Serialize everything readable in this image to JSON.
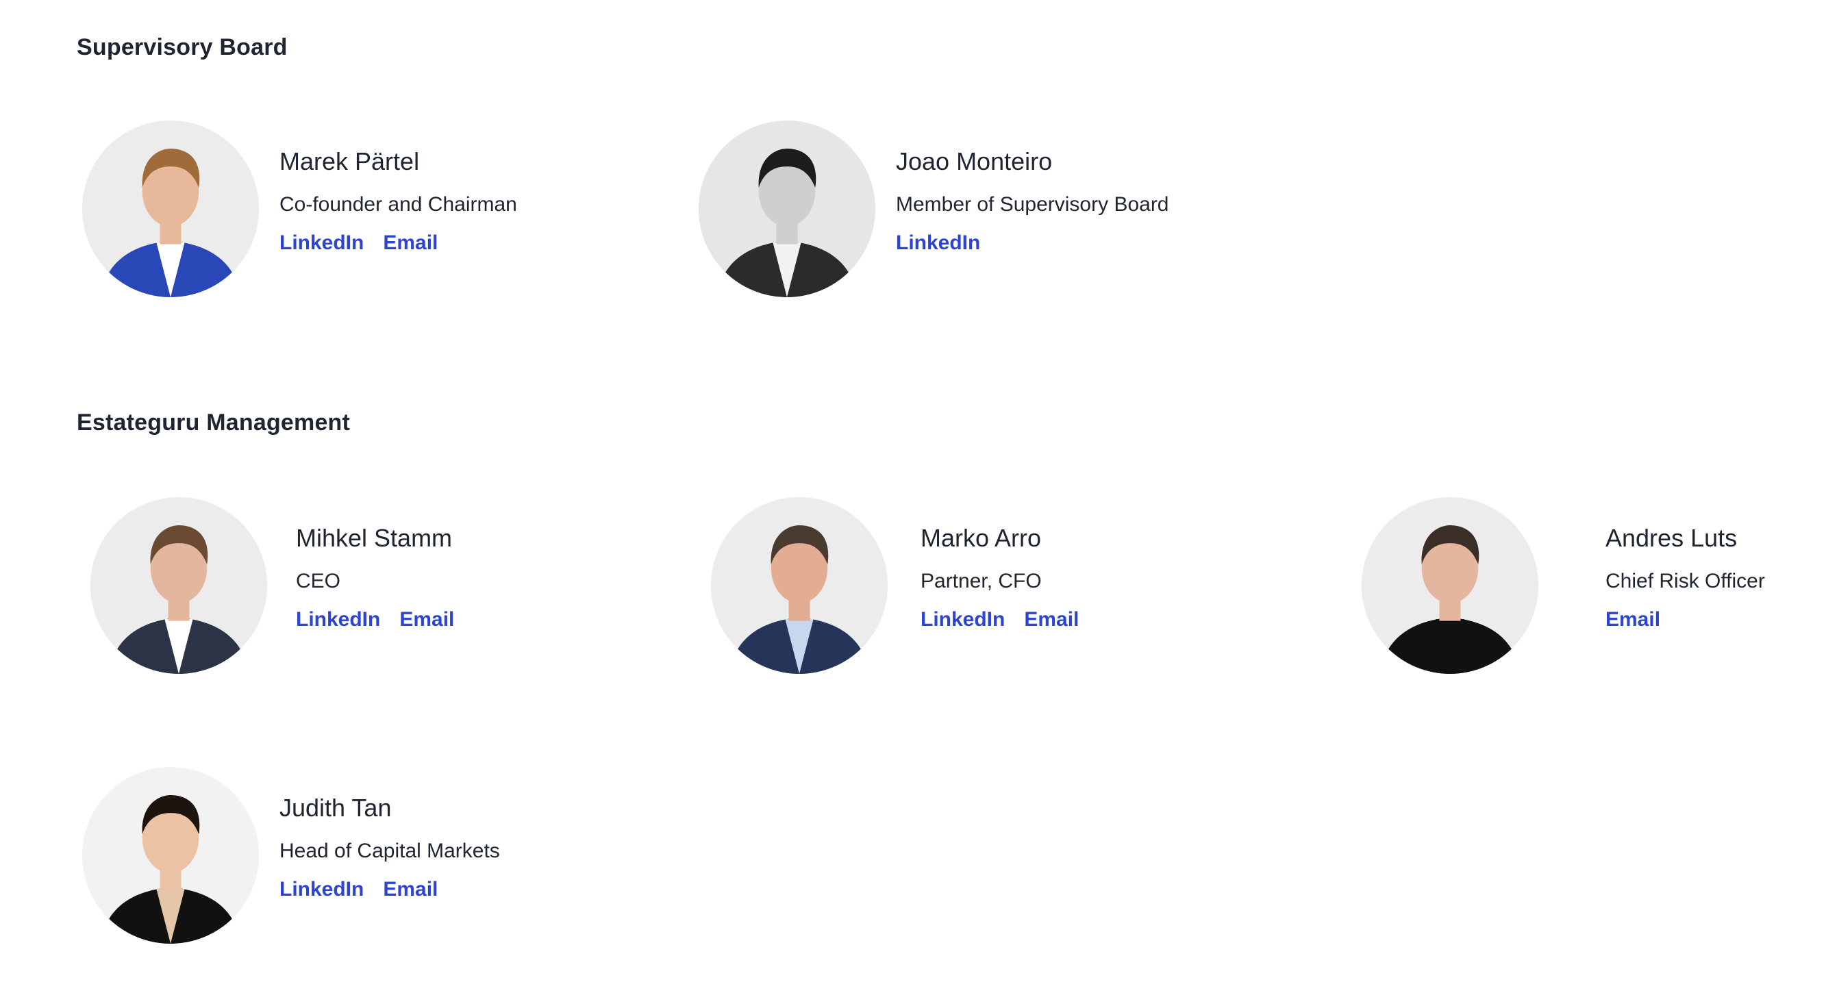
{
  "sections": [
    {
      "title": "Supervisory Board",
      "members": [
        {
          "name": "Marek Pärtel",
          "role": "Co-founder and Chairman",
          "links": [
            "LinkedIn",
            "Email"
          ],
          "photo": {
            "background": "#ececec",
            "skin": "#e8b89a",
            "hair": "#a06b3a",
            "suit": "#2a47b8",
            "shirt": "#ffffff"
          }
        },
        {
          "name": "Joao Monteiro",
          "role": "Member of Supervisory Board",
          "links": [
            "LinkedIn"
          ],
          "photo": {
            "background": "#e6e6e6",
            "skin": "#cfcfcf",
            "hair": "#1c1c1c",
            "suit": "#2b2b2b",
            "shirt": "#f2f2f2"
          }
        }
      ]
    },
    {
      "title": "Estateguru Management",
      "members": [
        {
          "name": "Mihkel Stamm",
          "role": "CEO",
          "links": [
            "LinkedIn",
            "Email"
          ],
          "photo": {
            "background": "#ececec",
            "skin": "#e3b79e",
            "hair": "#6b4a33",
            "suit": "#2c3347",
            "shirt": "#ffffff"
          }
        },
        {
          "name": "Marko Arro",
          "role": "Partner, CFO",
          "links": [
            "LinkedIn",
            "Email"
          ],
          "photo": {
            "background": "#ececec",
            "skin": "#e2ad93",
            "hair": "#4a3b30",
            "suit": "#26345a",
            "shirt": "#c9d7ee"
          }
        },
        {
          "name": "Andres Luts",
          "role": "Chief Risk Officer",
          "links": [
            "Email"
          ],
          "photo": {
            "background": "#ececec",
            "skin": "#e4b69f",
            "hair": "#3b2e27",
            "suit": "#111111",
            "shirt": "#111111"
          }
        },
        {
          "name": "Judith Tan",
          "role": "Head of Capital Markets",
          "links": [
            "LinkedIn",
            "Email"
          ],
          "photo": {
            "background": "#f2f2f2",
            "skin": "#ebc3a4",
            "hair": "#1d1410",
            "suit": "#111111",
            "shirt": "#e6c6a8"
          }
        }
      ]
    }
  ]
}
